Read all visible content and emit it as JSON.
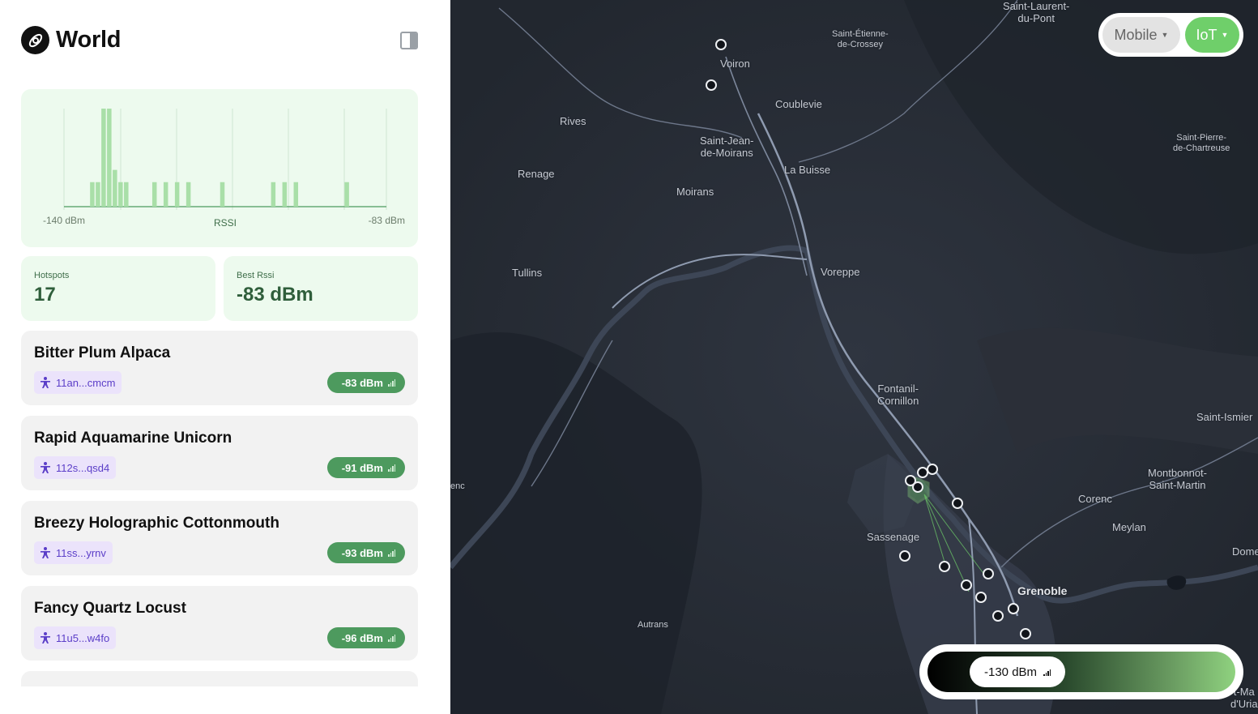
{
  "brand": {
    "name": "World"
  },
  "histogram": {
    "min_label": "-140 dBm",
    "max_label": "-83 dBm",
    "axis_label": "RSSI"
  },
  "chart_data": {
    "type": "bar",
    "title": "",
    "xlabel": "RSSI",
    "ylabel": "",
    "xlim": [
      -140,
      -83
    ],
    "x_unit": "dBm",
    "x": [
      -135,
      -134,
      -133,
      -132,
      -131,
      -130,
      -129,
      -124,
      -122,
      -120,
      -118,
      -112,
      -103,
      -101,
      -99,
      -90
    ],
    "values": [
      2,
      2,
      8,
      8,
      3,
      2,
      2,
      2,
      2,
      2,
      2,
      2,
      2,
      2,
      2,
      2
    ],
    "grid": true
  },
  "stats": {
    "hotspots_label": "Hotspots",
    "hotspots_value": "17",
    "best_rssi_label": "Best Rssi",
    "best_rssi_value": "-83 dBm"
  },
  "hotspots": [
    {
      "name": "Bitter Plum Alpaca",
      "id": "11an...cmcm",
      "rssi": "-83 dBm"
    },
    {
      "name": "Rapid Aquamarine Unicorn",
      "id": "112s...qsd4",
      "rssi": "-91 dBm"
    },
    {
      "name": "Breezy Holographic Cottonmouth",
      "id": "11ss...yrnv",
      "rssi": "-93 dBm"
    },
    {
      "name": "Fancy Quartz Locust",
      "id": "11u5...w4fo",
      "rssi": "-96 dBm"
    }
  ],
  "network": {
    "mobile_label": "Mobile",
    "iot_label": "IoT",
    "selected": "IoT",
    "accent": "#6fcf6a"
  },
  "legend": {
    "rssi_label": "-130 dBm"
  },
  "map": {
    "places": {
      "saint_laurent": "Saint-Laurent-\ndu-Pont",
      "saint_etienne": "Saint-Étienne-\nde-Crossey",
      "voiron": "Voiron",
      "coublevie": "Coublevie",
      "rives": "Rives",
      "saint_jean": "Saint-Jean-\nde-Moirans",
      "renage": "Renage",
      "la_buisse": "La Buisse",
      "moirans": "Moirans",
      "saint_pierre": "Saint-Pierre-\nde-Chartreuse",
      "tullins": "Tullins",
      "voreppe": "Voreppe",
      "fontanil": "Fontanil-\nCornillon",
      "saint_ismier": "Saint-Ismier",
      "montbonnot": "Montbonnot-\nSaint-Martin",
      "corenc": "Corenc",
      "meylan": "Meylan",
      "sassenage": "Sassenage",
      "grenoble": "Grenoble",
      "autrans": "Autrans",
      "enc": "enc",
      "dome": "Dome",
      "saint_martin_uriage": "t-Ma\nd'Uria"
    }
  }
}
